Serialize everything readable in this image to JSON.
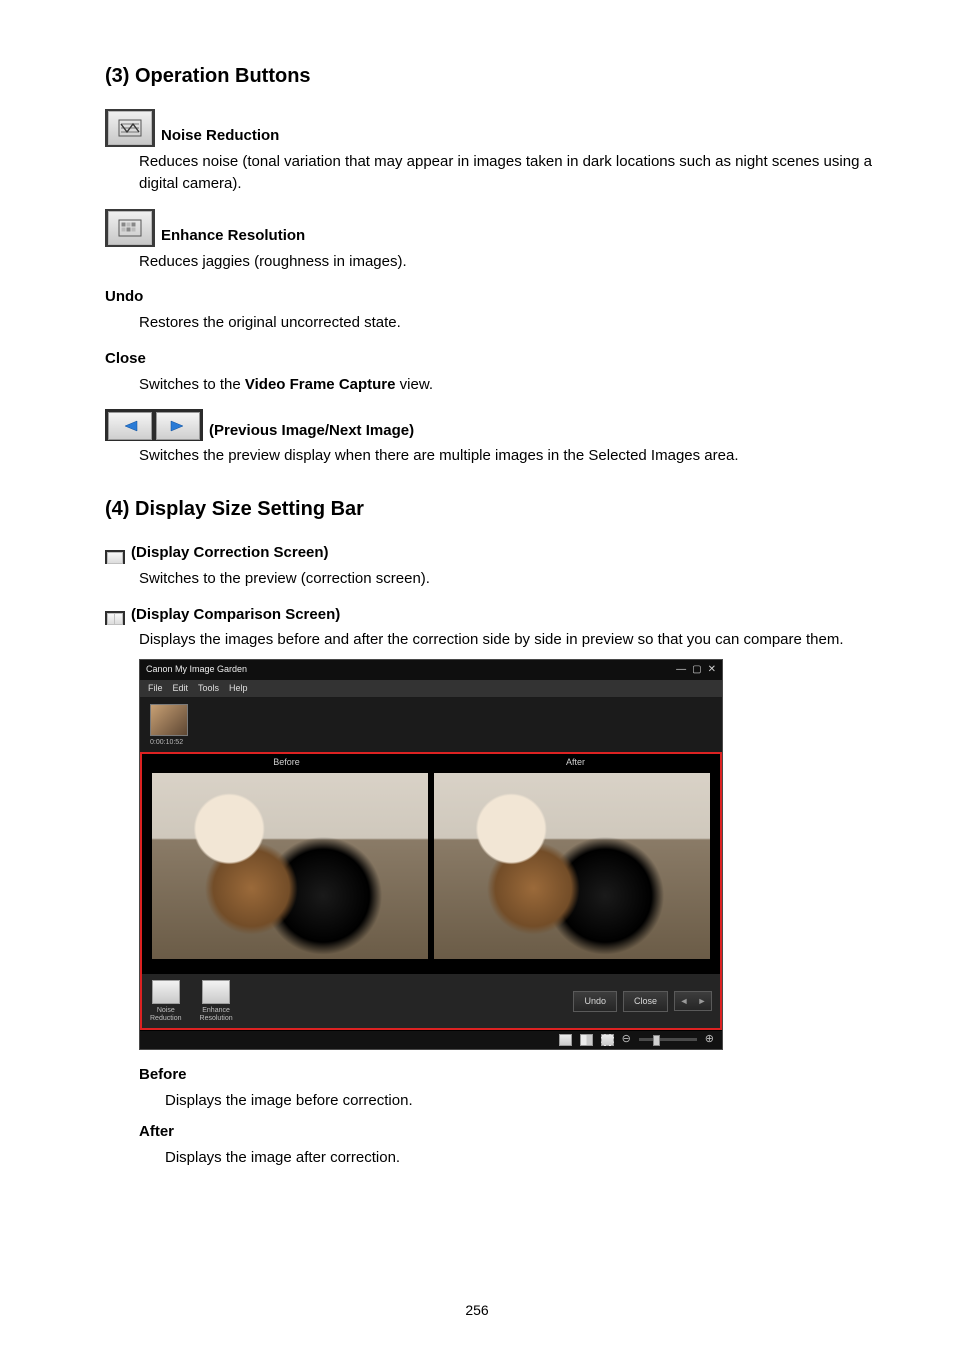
{
  "pageNumber": "256",
  "sections": {
    "s3": {
      "heading": "(3) Operation Buttons",
      "items": {
        "noise": {
          "title": "Noise Reduction",
          "body": "Reduces noise (tonal variation that may appear in images taken in dark locations such as night scenes using a digital camera)."
        },
        "enhance": {
          "title": "Enhance Resolution",
          "body": "Reduces jaggies (roughness in images)."
        },
        "undo": {
          "title": "Undo",
          "body": "Restores the original uncorrected state."
        },
        "close": {
          "title": "Close",
          "body_pre": "Switches to the ",
          "body_bold": "Video Frame Capture",
          "body_post": " view."
        },
        "prevnext": {
          "title": "(Previous Image/Next Image)",
          "body": "Switches the preview display when there are multiple images in the Selected Images area."
        }
      }
    },
    "s4": {
      "heading": "(4) Display Size Setting Bar",
      "items": {
        "correction": {
          "title": "(Display Correction Screen)",
          "body": "Switches to the preview (correction screen)."
        },
        "comparison": {
          "title": "(Display Comparison Screen)",
          "body": "Displays the images before and after the correction side by side in preview so that you can compare them."
        },
        "before": {
          "title": "Before",
          "body": "Displays the image before correction."
        },
        "after": {
          "title": "After",
          "body": "Displays the image after correction."
        }
      }
    }
  },
  "app": {
    "title": "Canon My Image Garden",
    "menu": [
      "File",
      "Edit",
      "Tools",
      "Help"
    ],
    "thumbTime": "0:00:10:52",
    "labels": {
      "before": "Before",
      "after": "After"
    },
    "ops": {
      "noise": "Noise\nReduction",
      "enhance": "Enhance\nResolution",
      "undo": "Undo",
      "close": "Close"
    }
  }
}
